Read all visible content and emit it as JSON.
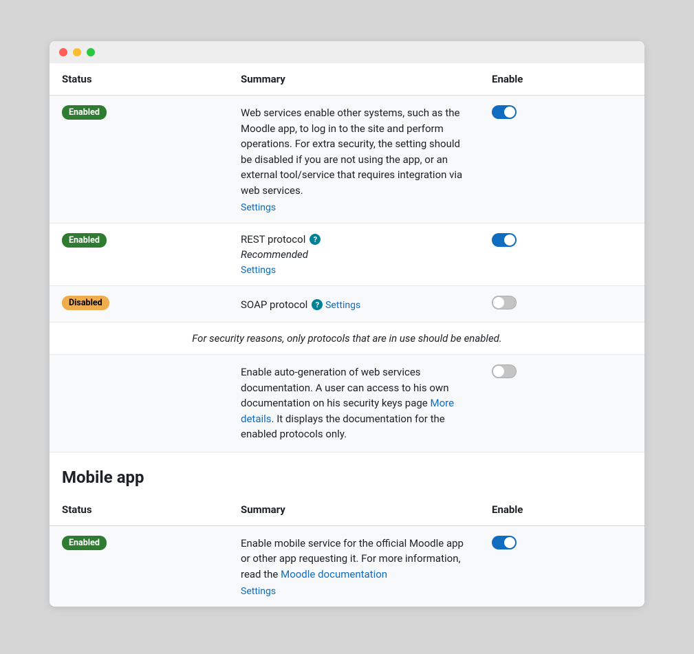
{
  "columns": {
    "status": "Status",
    "summary": "Summary",
    "enable": "Enable"
  },
  "badges": {
    "enabled": "Enabled",
    "disabled": "Disabled"
  },
  "links": {
    "settings": "Settings"
  },
  "web_services": {
    "row1": {
      "status": "Enabled",
      "desc": "Web services enable other systems, such as the Moodle app, to log in to the site and perform operations. For extra security, the setting should be disabled if you are not using the app, or an external tool/service that requires integration via web services."
    },
    "row2": {
      "status": "Enabled",
      "title": "REST protocol",
      "note": "Recommended"
    },
    "row3": {
      "status": "Disabled",
      "title": "SOAP protocol"
    },
    "note": "For security reasons, only protocols that are in use should be enabled.",
    "row4": {
      "desc_pre": "Enable auto-generation of web services documentation. A user can access to his own documentation on his security keys page ",
      "link": "More details",
      "desc_post": ". It displays the documentation for the enabled protocols only."
    }
  },
  "mobile": {
    "heading": "Mobile app",
    "row1": {
      "status": "Enabled",
      "desc_pre": "Enable mobile service for the official Moodle app or other app requesting it. For more information, read the ",
      "link": "Moodle documentation"
    }
  }
}
